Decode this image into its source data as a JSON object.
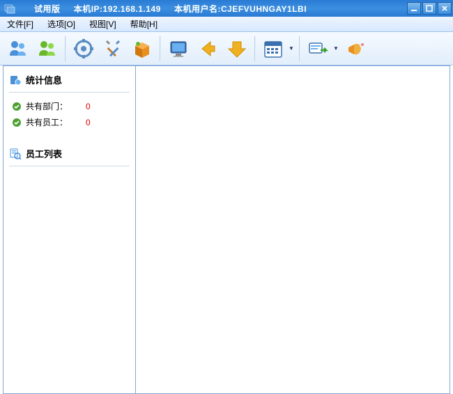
{
  "titlebar": {
    "version": "试用版",
    "ip_label": "本机IP:",
    "ip_value": "192.168.1.149",
    "user_label": "本机用户名:",
    "user_value": "CJEFVUHNGAY1LBI"
  },
  "menubar": {
    "file": "文件[F]",
    "options": "选项[O]",
    "view": "视图[V]",
    "help": "帮助[H]"
  },
  "toolbar": {
    "icons": {
      "users_blue": "users-blue-icon",
      "users_green": "users-green-icon",
      "gear": "gear-icon",
      "tools": "tools-icon",
      "package": "package-icon",
      "monitor": "monitor-icon",
      "arrow_left": "arrow-left-icon",
      "arrow_down": "arrow-down-icon",
      "calendar": "calendar-icon",
      "send": "send-icon",
      "announce": "announce-icon"
    }
  },
  "sidebar": {
    "stats_title": "统计信息",
    "rows": [
      {
        "label": "共有部门：",
        "value": "0"
      },
      {
        "label": "共有员工：",
        "value": "0"
      }
    ],
    "list_title": "员工列表"
  }
}
